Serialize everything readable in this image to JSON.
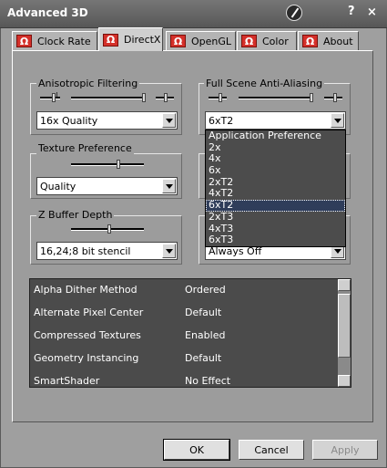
{
  "window": {
    "title": "Advanced 3D",
    "help": "?",
    "close": "×"
  },
  "tabs": [
    {
      "label": "Clock Rate",
      "active": false
    },
    {
      "label": "DirectX",
      "active": true
    },
    {
      "label": "OpenGL",
      "active": false
    },
    {
      "label": "Color",
      "active": false
    },
    {
      "label": "About",
      "active": false
    }
  ],
  "tab_icon_glyph": "Ω",
  "groups": {
    "anisotropic": {
      "label": "Anisotropic Filtering",
      "value": "16x Quality"
    },
    "fsaa": {
      "label": "Full Scene Anti-Aliasing",
      "value": "6xT2"
    },
    "texture": {
      "label": "Texture Preference",
      "value": "Quality"
    },
    "zbuffer": {
      "label": "Z Buffer Depth",
      "value": "16,24;8 bit stencil"
    },
    "hidden_group_value": "Always Off"
  },
  "fsaa_options": [
    "Application Preference",
    "2x",
    "4x",
    "6x",
    "2xT2",
    "4xT2",
    "6xT2",
    "2xT3",
    "4xT3",
    "6xT3"
  ],
  "fsaa_selected_index": 6,
  "properties": [
    {
      "name": "Alpha Dither Method",
      "value": "Ordered"
    },
    {
      "name": "Alternate Pixel Center",
      "value": "Default"
    },
    {
      "name": "Compressed Textures",
      "value": "Enabled"
    },
    {
      "name": "Geometry Instancing",
      "value": "Default"
    },
    {
      "name": "SmartShader",
      "value": "No Effect"
    }
  ],
  "buttons": {
    "ok": "OK",
    "cancel": "Cancel",
    "apply": "Apply"
  },
  "colors": {
    "tab_icon": "#d4302a",
    "selection": "#2f3d5a"
  }
}
